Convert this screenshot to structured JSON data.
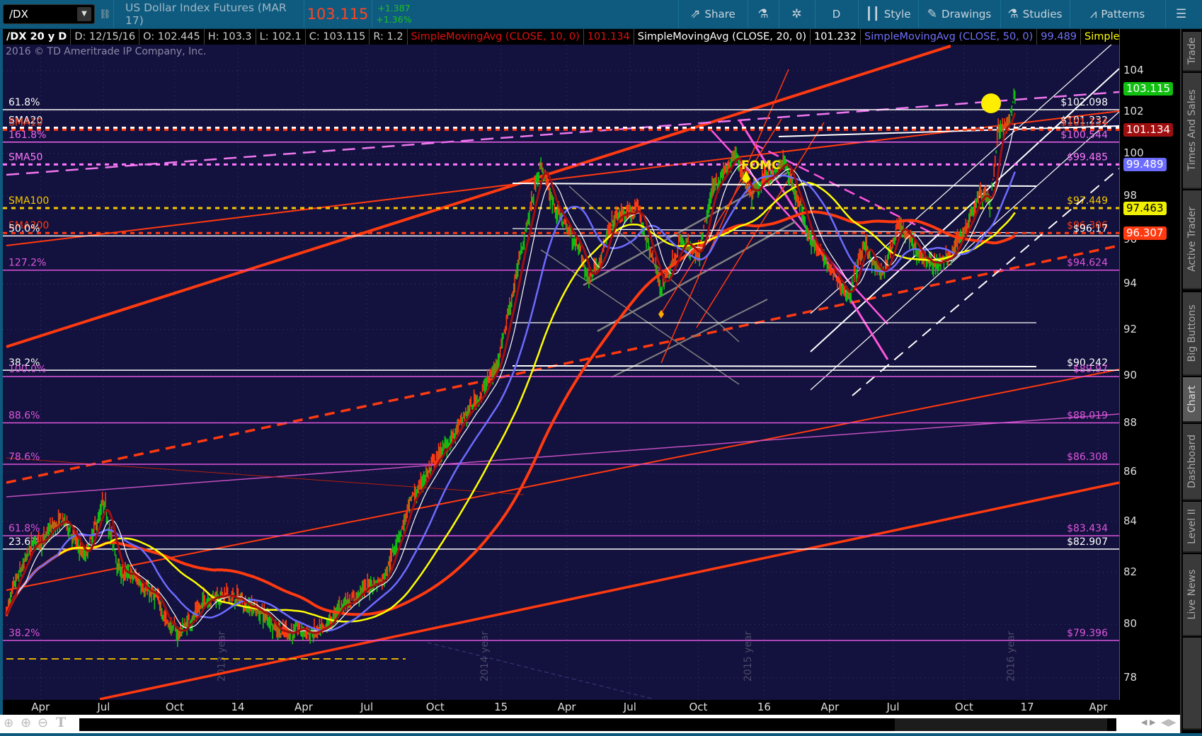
{
  "toolbar": {
    "symbol": "/DX",
    "description": "US Dollar Index Futures (MAR 17)",
    "last": "103.115",
    "change": "+1.387",
    "change_pct": "+1.36%",
    "buttons": [
      {
        "label": "Share",
        "icon": "share-icon"
      },
      {
        "label": "",
        "icon": "flask-icon"
      },
      {
        "label": "",
        "icon": "gear-icon"
      },
      {
        "label": "D",
        "icon": ""
      },
      {
        "label": "Style",
        "icon": "candles-icon"
      },
      {
        "label": "Drawings",
        "icon": "pencil-icon"
      },
      {
        "label": "Studies",
        "icon": "flask-icon"
      },
      {
        "label": "Patterns",
        "icon": "patterns-icon"
      },
      {
        "label": "",
        "icon": "menu-icon"
      }
    ]
  },
  "legend": {
    "title": "/DX 20 y D",
    "date": "D: 12/15/16",
    "open": "O: 102.445",
    "high": "H: 103.3",
    "low": "L: 102.1",
    "close": "C: 103.115",
    "range": "R: 1.2",
    "studies": [
      {
        "name": "SimpleMovingAvg (CLOSE, 10, 0)",
        "value": "101.134",
        "color": "#e01010"
      },
      {
        "name": "SimpleMovingAvg (CLOSE, 20, 0)",
        "value": "101.232",
        "color": "#ffffff"
      },
      {
        "name": "SimpleMovingAvg (CLOSE, 50, 0)",
        "value": "99.489",
        "color": "#6c6cff"
      },
      {
        "name": "Simple...",
        "value": "",
        "color": "#ffff00"
      }
    ]
  },
  "copyright": "2016 © TD Ameritrade IP Company, Inc.",
  "annotation": "FOMC",
  "sidebar": [
    "Trade",
    "Times And Sales",
    "Active Trader",
    "Big Buttons",
    "Chart",
    "Dashboard",
    "Level II",
    "Live News"
  ],
  "sidebar_selected": "Chart",
  "chart_data": {
    "type": "candlestick",
    "yscale": "log",
    "ylim": [
      77.2,
      105.5
    ],
    "yticks": [
      78,
      80,
      82,
      84,
      86,
      88,
      90,
      92,
      94,
      96,
      98,
      100,
      102,
      104
    ],
    "xticks": [
      {
        "label": "Apr",
        "t": 2013.25
      },
      {
        "label": "Jul",
        "t": 2013.49
      },
      {
        "label": "Oct",
        "t": 2013.76
      },
      {
        "label": "14",
        "t": 2014
      },
      {
        "label": "Apr",
        "t": 2014.25
      },
      {
        "label": "Jul",
        "t": 2014.49
      },
      {
        "label": "Oct",
        "t": 2014.75
      },
      {
        "label": "15",
        "t": 2015
      },
      {
        "label": "Apr",
        "t": 2015.25
      },
      {
        "label": "Jul",
        "t": 2015.49
      },
      {
        "label": "Oct",
        "t": 2015.75
      },
      {
        "label": "16",
        "t": 2016
      },
      {
        "label": "Apr",
        "t": 2016.25
      },
      {
        "label": "Jul",
        "t": 2016.49
      },
      {
        "label": "Oct",
        "t": 2016.76
      },
      {
        "label": "17",
        "t": 2017
      },
      {
        "label": "Apr",
        "t": 2017.27
      }
    ],
    "year_labels": [
      {
        "label": "2013 year",
        "t": 2013.95
      },
      {
        "label": "2014 year",
        "t": 2014.95
      },
      {
        "label": "2015 year",
        "t": 2015.95
      },
      {
        "label": "2016 year",
        "t": 2016.95
      }
    ],
    "price_path": [
      [
        2013.12,
        80.5
      ],
      [
        2013.22,
        83
      ],
      [
        2013.34,
        84
      ],
      [
        2013.42,
        82.5
      ],
      [
        2013.49,
        84.6
      ],
      [
        2013.55,
        82
      ],
      [
        2013.65,
        81.5
      ],
      [
        2013.77,
        79.6
      ],
      [
        2013.9,
        81.2
      ],
      [
        2014.04,
        80.8
      ],
      [
        2014.17,
        79.8
      ],
      [
        2014.33,
        79.6
      ],
      [
        2014.4,
        80.8
      ],
      [
        2014.55,
        81.8
      ],
      [
        2014.65,
        84.5
      ],
      [
        2014.71,
        85.8
      ],
      [
        2014.84,
        87.8
      ],
      [
        2014.98,
        90.3
      ],
      [
        2015.06,
        94.5
      ],
      [
        2015.15,
        99.6
      ],
      [
        2015.2,
        97.6
      ],
      [
        2015.3,
        95.5
      ],
      [
        2015.33,
        94.2
      ],
      [
        2015.44,
        97
      ],
      [
        2015.52,
        97.3
      ],
      [
        2015.61,
        93.8
      ],
      [
        2015.68,
        96
      ],
      [
        2015.75,
        95
      ],
      [
        2015.81,
        98.5
      ],
      [
        2015.89,
        99.8
      ],
      [
        2015.95,
        98.3
      ],
      [
        2016.0,
        98.8
      ],
      [
        2016.08,
        99.5
      ],
      [
        2016.18,
        96
      ],
      [
        2016.27,
        94.2
      ],
      [
        2016.32,
        93.5
      ],
      [
        2016.38,
        95.7
      ],
      [
        2016.45,
        94.3
      ],
      [
        2016.51,
        96.5
      ],
      [
        2016.6,
        95.2
      ],
      [
        2016.68,
        94.8
      ],
      [
        2016.75,
        96.2
      ],
      [
        2016.82,
        98.3
      ],
      [
        2016.86,
        97.6
      ],
      [
        2016.89,
        101.2
      ],
      [
        2016.93,
        101.3
      ],
      [
        2016.955,
        103.115
      ]
    ],
    "moving_averages": [
      {
        "name": "SMA10",
        "length": 10,
        "color": "#a00f0f"
      },
      {
        "name": "SMA20",
        "length": 20,
        "color": "#ffffff"
      },
      {
        "name": "SMA50",
        "length": 50,
        "color": "#6c6cff"
      },
      {
        "name": "SMA100",
        "length": 100,
        "color": "#ffff00"
      },
      {
        "name": "SMA200",
        "length": 200,
        "color": "#ff3a10"
      }
    ],
    "levels": [
      {
        "left": "61.8%",
        "right": "$102.098",
        "price": 102.098,
        "color": "#ffffff",
        "style": "solid"
      },
      {
        "left": "SMA20",
        "right": "$101.232",
        "price": 101.232,
        "color": "#ffffff",
        "style": "dotted"
      },
      {
        "left": "SMA10",
        "right": "$101.134",
        "price": 101.134,
        "color": "#ff3a10",
        "style": "dotted"
      },
      {
        "left": "161.8%",
        "right": "$100.544",
        "price": 100.544,
        "color": "#ee66ee",
        "style": "solid"
      },
      {
        "left": "SMA50",
        "right": "$99.485",
        "price": 99.485,
        "color": "#ff77ff",
        "style": "dotted"
      },
      {
        "left": "SMA100",
        "right": "$97.449",
        "price": 97.449,
        "color": "#f5c800",
        "style": "dotted"
      },
      {
        "left": "SMA200",
        "right": "$96.306",
        "price": 96.306,
        "color": "#ff3a10",
        "style": "dotted"
      },
      {
        "left": "50.0%",
        "right": "$96.17",
        "price": 96.17,
        "color": "#ffffff",
        "style": "solid"
      },
      {
        "left": "127.2%",
        "right": "$94.624",
        "price": 94.624,
        "color": "#dd55dd",
        "style": "solid"
      },
      {
        "left": "38.2%",
        "right": "$90.242",
        "price": 90.242,
        "color": "#ffffff",
        "style": "solid"
      },
      {
        "left": "100.0%",
        "right": "$89.97",
        "price": 89.97,
        "color": "#dd55dd",
        "style": "solid"
      },
      {
        "left": "88.6%",
        "right": "$88.019",
        "price": 88.019,
        "color": "#dd55dd",
        "style": "solid"
      },
      {
        "left": "78.6%",
        "right": "$86.308",
        "price": 86.308,
        "color": "#dd55dd",
        "style": "solid"
      },
      {
        "left": "61.8%",
        "right": "$83.434",
        "price": 83.434,
        "color": "#dd55dd",
        "style": "solid"
      },
      {
        "left": "23.6%",
        "right": "$82.907",
        "price": 82.907,
        "color": "#ffffff",
        "style": "solid"
      },
      {
        "left": "38.2%",
        "right": "$79.396",
        "price": 79.396,
        "color": "#dd55dd",
        "style": "solid"
      }
    ],
    "badges": [
      {
        "value": "103.115",
        "price": 103.115,
        "bg": "#10c010",
        "fg": "#ffffff"
      },
      {
        "value": "101.134",
        "price": 101.134,
        "bg": "#a00f0f",
        "fg": "#ffffff"
      },
      {
        "value": "99.489",
        "price": 99.489,
        "bg": "#6c6cff",
        "fg": "#ffffff"
      },
      {
        "value": "97.463",
        "price": 97.463,
        "bg": "#f0f000",
        "fg": "#000000"
      },
      {
        "value": "96.307",
        "price": 96.307,
        "bg": "#ff3a10",
        "fg": "#ffffff"
      }
    ]
  }
}
